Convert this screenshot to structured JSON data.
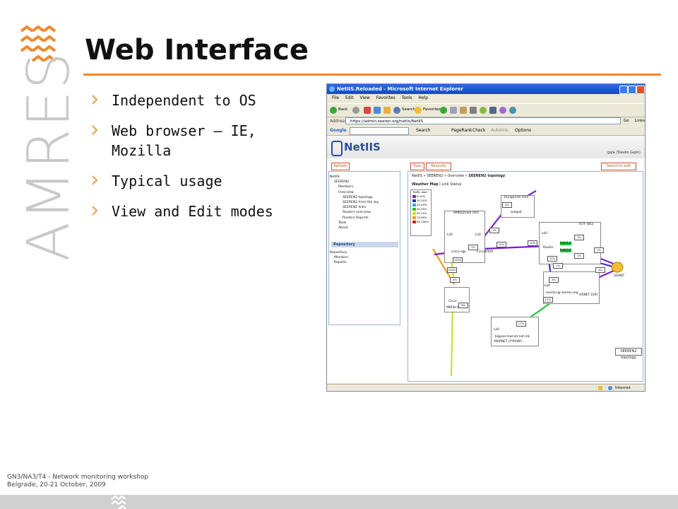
{
  "slide": {
    "title": "Web Interface",
    "vertical_brand": "AMRES",
    "bullets": [
      "Independent to OS",
      "Web browser – IE, Mozilla",
      "Typical usage",
      "View and Edit modes"
    ],
    "footer_line1": "GN3/NA3/T4 - Network monitoring workshop",
    "footer_line2": "Belgrade, 20-21 October, 2009",
    "accent_color": "#f08a2c"
  },
  "browser": {
    "window_title": "NetIIS.Reloaded - Microsoft Internet Explorer",
    "menu": [
      "File",
      "Edit",
      "View",
      "Favorites",
      "Tools",
      "Help"
    ],
    "toolbar": {
      "back": "Back",
      "search": "Search",
      "favorites": "Favorites"
    },
    "address_label": "Address",
    "address_value": "https://admin.seeren.org/netiis/NetIIS",
    "go_label": "Go",
    "links_label": "Links",
    "google_bar": {
      "brand": "Google",
      "search": "Search",
      "pagerank": "PageRank",
      "check": "Check",
      "autolink": "Autolink",
      "options": "Options"
    },
    "status_left": "",
    "status_right": "Internet"
  },
  "app": {
    "brand": "NetIIS",
    "user": "gaja (Slavko Gajin)",
    "refresh": "Refresh",
    "tools": "Tools",
    "recently_used": "Recently used",
    "switch_mode": "Switch to edit mode",
    "breadcrumb": [
      "NetIIS",
      "SEEREN2",
      "Overview",
      "SEEREN2 topology"
    ],
    "tabs": [
      "Weather Map",
      "Link Status"
    ],
    "tree": [
      "NetIIS",
      "SEEREN2",
      "Members",
      "Overview",
      "SEEREN2 topology",
      "SEEREN2 from the sky",
      "SEEREN2 links",
      "Routers overview",
      "Routers Reports",
      "Tools",
      "About"
    ],
    "repository_header": "Repository",
    "repository_tree": [
      "Repository",
      "Monitors",
      "Reports"
    ],
    "legend_title": "Traffic load",
    "legend": [
      {
        "label": "0-10%",
        "color": "#7b20c8"
      },
      {
        "label": "10-25%",
        "color": "#2f2fd0"
      },
      {
        "label": "25-40%",
        "color": "#2aa6e0"
      },
      {
        "label": "40-55%",
        "color": "#22c23a"
      },
      {
        "label": "55-70%",
        "color": "#c8e030"
      },
      {
        "label": "70-85%",
        "color": "#f0a020"
      },
      {
        "label": "85-100%",
        "color": "#d02020"
      }
    ],
    "nodes": {
      "amrej": "AMREJ/Uodi (SR)",
      "hungarnet": "Hungarnet (HU)",
      "istf": "ISTF (BG)",
      "mren": "MREN (MNT)",
      "grnet": "GRNET (GR)",
      "marnet": "MARNET (FYROM)",
      "geant": "GEANT"
    },
    "labels": {
      "lo0a": "Lo0",
      "lo0b": "Lo0",
      "cisco_ngp": "cisco-ngp",
      "cisco6509": "Cisco6509",
      "szeged": "szeged",
      "lo0c": "Lo0",
      "router": "Router",
      "fa010": "Fa0/1.0",
      "fa030": "Fa0/3.0",
      "cisco": "Cisco",
      "seeren_gr": "seeren-gr.seeren.org",
      "lo0d": "Lo0",
      "lo0e": "Lo0",
      "bigone": "bigone.marnet.net.mk",
      "topology_btn": "SEEREN2 topology"
    },
    "percents": [
      "4%",
      "1%",
      "10%",
      "1%",
      "10%",
      "1%",
      "1%",
      "1%",
      "10%",
      "1%",
      "100%",
      "4%",
      "4%",
      "21%",
      "8%",
      "4%",
      "17%",
      "100%"
    ]
  }
}
